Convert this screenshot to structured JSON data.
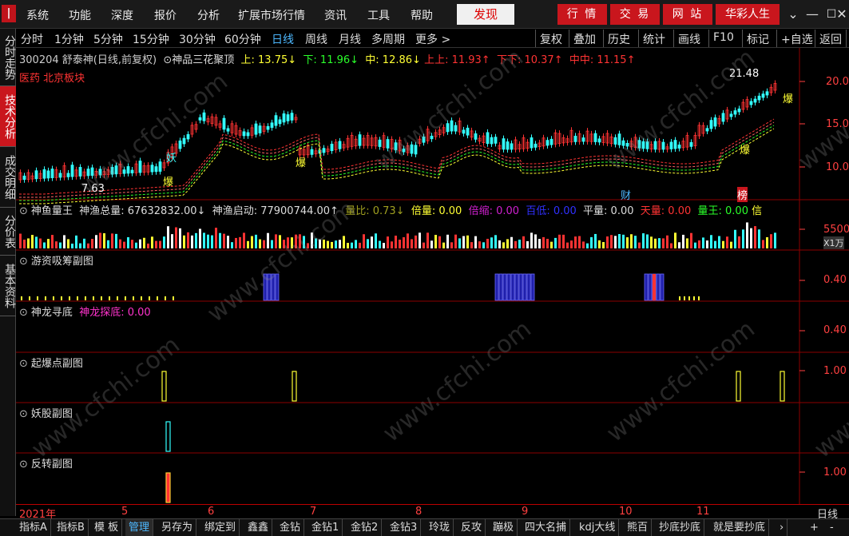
{
  "menu": {
    "logo": "|",
    "items": [
      "系统",
      "功能",
      "深度",
      "报价",
      "分析",
      "扩展市场行情",
      "资讯",
      "工具",
      "帮助"
    ],
    "faxian": "发现",
    "top_buttons": [
      "行 情",
      "交 易",
      "网 站",
      "华彩人生"
    ],
    "window_controls": [
      "⌄",
      "—",
      "☐",
      "✕"
    ]
  },
  "left_tabs": [
    {
      "label": "分时走势",
      "active": false
    },
    {
      "label": "技术分析",
      "active": true
    },
    {
      "label": "成交明细",
      "active": false
    },
    {
      "label": "分价表",
      "active": false
    },
    {
      "label": "基本资料",
      "active": false
    }
  ],
  "periods": [
    "分时",
    "1分钟",
    "5分钟",
    "15分钟",
    "30分钟",
    "60分钟",
    "日线",
    "周线",
    "月线",
    "多周期",
    "更多 >"
  ],
  "active_period": "日线",
  "tools": [
    "复权",
    "叠加",
    "历史",
    "统计",
    "画线",
    "F10",
    "标记",
    "+自选",
    "返回"
  ],
  "price_header": {
    "code": "300204 舒泰神(日线,前复权)",
    "indicator": "神品三花聚顶",
    "up": "上: 13.75↓",
    "down": "下: 11.96↓",
    "mid": "中: 12.86↓",
    "upup": "上上: 11.93↑",
    "downdown": "下下: 10.37↑",
    "midmid": "中中: 11.15↑"
  },
  "sector": "医药  北京板块",
  "price_axis": [
    "20.00",
    "15.00",
    "10.00"
  ],
  "price_high_label": "21.48",
  "price_low_label": "7.63",
  "markers": {
    "bao": "爆",
    "yao": "妖",
    "cai": "财",
    "bang": "榜"
  },
  "volume_header": {
    "title": "神鱼量王",
    "total": "神渔总量: 67632832.00↓",
    "start": "神渔启动: 77900744.00↑",
    "liangbi": "量比: 0.73↓",
    "beiliang": "倍量: 0.00",
    "beisuo": "倍缩: 0.00",
    "baidi": "百低: 0.00",
    "pingliang": "平量: 0.00",
    "tianliang": "天量: 0.00",
    "liangwang": "量王: 0.00",
    "more": "信"
  },
  "volume_axis": "55000",
  "volume_unit": "X1万",
  "sub_panels": [
    {
      "title": "游资吸筹副图",
      "extra": "",
      "axis": "0.40"
    },
    {
      "title": "神龙寻底",
      "extra": "神龙探底: 0.00",
      "axis": "0.40"
    },
    {
      "title": "起爆点副图",
      "extra": "",
      "axis": "1.00"
    },
    {
      "title": "妖股副图",
      "extra": "",
      "axis": ""
    },
    {
      "title": "反转副图",
      "extra": "",
      "axis": "1.00"
    }
  ],
  "timeline": {
    "labels": [
      "2021年",
      "5",
      "6",
      "7",
      "8",
      "9",
      "10",
      "11"
    ],
    "period": "日线"
  },
  "bottom_tabs": [
    "指标A",
    "指标B",
    "模 板",
    "管理",
    "另存为",
    "绑定到",
    "鑫鑫",
    "金钻",
    "金钻1",
    "金钻2",
    "金钻3",
    "玲珑",
    "反攻",
    "蹦极",
    "四大名捕",
    "kdj大线",
    "熊百",
    "抄底抄底",
    "就是要抄底",
    "›",
    "+",
    "-"
  ],
  "active_bottom_tab": "管理",
  "watermark": "www.cfchi.com",
  "colors": {
    "up": "#ff3333",
    "down": "#33ffff",
    "accent": "#c9161d",
    "active_blue": "#4db8ff"
  }
}
